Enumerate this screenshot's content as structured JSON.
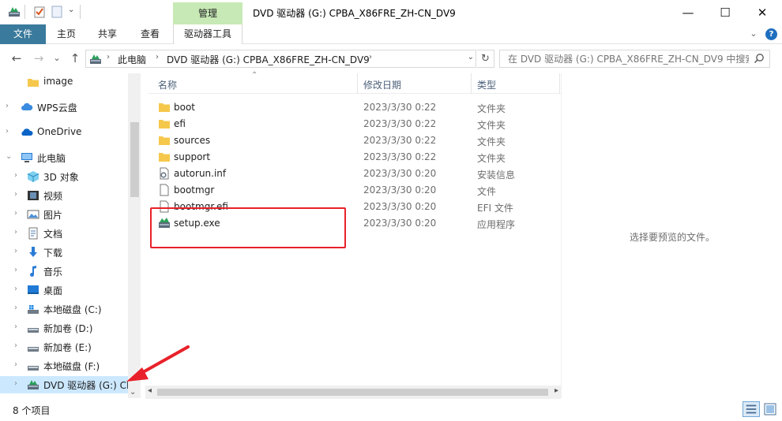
{
  "window": {
    "title": "DVD 驱动器 (G:) CPBA_X86FRE_ZH-CN_DV9",
    "contextual_tab": "管理",
    "controls": {
      "minimize": "—",
      "maximize": "☐",
      "close": "✕"
    }
  },
  "ribbon": {
    "tabs": [
      {
        "label": "文件"
      },
      {
        "label": "主页"
      },
      {
        "label": "共享"
      },
      {
        "label": "查看"
      },
      {
        "label": "驱动器工具"
      }
    ],
    "expand_glyph": "⌄",
    "help_glyph": "?"
  },
  "address": {
    "back": "←",
    "forward": "→",
    "history": "⌄",
    "up": "↑",
    "crumbs": [
      "此电脑",
      "DVD 驱动器 (G:) CPBA_X86FRE_ZH-CN_DV9"
    ],
    "separator": "›",
    "refresh": "↻",
    "search_placeholder": "在 DVD 驱动器 (G:) CPBA_X86FRE_ZH-CN_DV9 中搜索"
  },
  "nav": {
    "items": [
      {
        "label": "image",
        "icon": "folder-icon",
        "chevron": ""
      },
      {
        "label": "WPS云盘",
        "icon": "cloud-icon",
        "chevron": "›"
      },
      {
        "label": "OneDrive",
        "icon": "onedrive-icon",
        "chevron": "›"
      },
      {
        "label": "此电脑",
        "icon": "computer-icon",
        "chevron": "⌄"
      },
      {
        "label": "3D 对象",
        "icon": "3d-objects-icon",
        "chevron": "›"
      },
      {
        "label": "视频",
        "icon": "video-icon",
        "chevron": "›"
      },
      {
        "label": "图片",
        "icon": "pictures-icon",
        "chevron": "›"
      },
      {
        "label": "文档",
        "icon": "documents-icon",
        "chevron": "›"
      },
      {
        "label": "下载",
        "icon": "download-icon",
        "chevron": "›"
      },
      {
        "label": "音乐",
        "icon": "music-icon",
        "chevron": "›"
      },
      {
        "label": "桌面",
        "icon": "desktop-icon",
        "chevron": "›"
      },
      {
        "label": "本地磁盘 (C:)",
        "icon": "system-drive-icon",
        "chevron": "›"
      },
      {
        "label": "新加卷 (D:)",
        "icon": "drive-icon",
        "chevron": "›"
      },
      {
        "label": "新加卷 (E:)",
        "icon": "drive-icon",
        "chevron": "›"
      },
      {
        "label": "本地磁盘 (F:)",
        "icon": "drive-icon",
        "chevron": "›"
      },
      {
        "label": "DVD 驱动器 (G:) CF",
        "icon": "dvd-drive-icon",
        "chevron": "›",
        "selected": true
      }
    ]
  },
  "columns": {
    "name": "名称",
    "date": "修改日期",
    "type": "类型"
  },
  "files": [
    {
      "name": "boot",
      "date": "2023/3/30 0:22",
      "type": "文件夹",
      "icon": "folder-icon"
    },
    {
      "name": "efi",
      "date": "2023/3/30 0:22",
      "type": "文件夹",
      "icon": "folder-icon"
    },
    {
      "name": "sources",
      "date": "2023/3/30 0:22",
      "type": "文件夹",
      "icon": "folder-icon"
    },
    {
      "name": "support",
      "date": "2023/3/30 0:22",
      "type": "文件夹",
      "icon": "folder-icon"
    },
    {
      "name": "autorun.inf",
      "date": "2023/3/30 0:20",
      "type": "安装信息",
      "icon": "settings-file-icon"
    },
    {
      "name": "bootmgr",
      "date": "2023/3/30 0:20",
      "type": "文件",
      "icon": "file-icon"
    },
    {
      "name": "bootmgr.efi",
      "date": "2023/3/30 0:20",
      "type": "EFI 文件",
      "icon": "file-icon"
    },
    {
      "name": "setup.exe",
      "date": "2023/3/30 0:20",
      "type": "应用程序",
      "icon": "setup-app-icon"
    }
  ],
  "preview": {
    "empty_text": "选择要预览的文件。"
  },
  "status": {
    "item_count": "8 个项目"
  },
  "colors": {
    "file_tab": "#3a7a9c",
    "manage_tab": "#c7e9b5",
    "selection": "#cce8ff",
    "annotation": "#e8212a",
    "folder": "#f5c84c"
  }
}
